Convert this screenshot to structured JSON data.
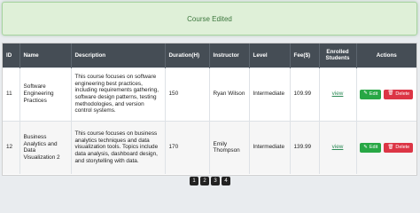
{
  "alert": {
    "message": "Course Edited"
  },
  "table": {
    "headers": [
      "ID",
      "Name",
      "Description",
      "Duration(H)",
      "Instructor",
      "Level",
      "Fee($)",
      "Enrolled Students",
      "Actions"
    ],
    "rows": [
      {
        "id": "11",
        "name": "Software Engineering Practices",
        "description": "This course focuses on software engineering best practices, including requirements gathering, software design patterns, testing methodologies, and version control systems.",
        "duration": "150",
        "instructor": "Ryan Wilson",
        "level": "Intermediate",
        "fee": "109.99",
        "enrolled": "view",
        "edit": "Edit",
        "delete": "Delete"
      },
      {
        "id": "12",
        "name": "Business Analytics and Data Visualization 2",
        "description": "This course focuses on business analytics techniques and data visualization tools. Topics include data analysis, dashboard design, and storytelling with data.",
        "duration": "170",
        "instructor": "Emily Thompson",
        "level": "Intermediate",
        "fee": "139.99",
        "enrolled": "view",
        "edit": "Edit",
        "delete": "Delete"
      }
    ]
  },
  "pagination": {
    "pages": [
      "1",
      "2",
      "3",
      "4"
    ]
  },
  "icons": {
    "edit": "edit-icon",
    "delete": "trash-icon"
  },
  "colors": {
    "success": "#28a745",
    "danger": "#dc3545",
    "header": "#454d55",
    "link": "#2e8b57"
  }
}
